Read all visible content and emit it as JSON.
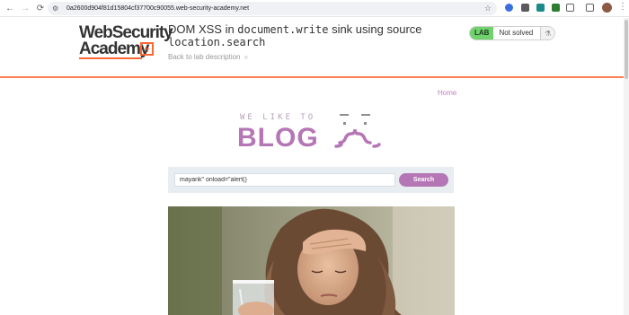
{
  "browser": {
    "url": "0a2600d904f81d15804cf37700c90055.web-security-academy.net",
    "back_glyph": "←",
    "forward_glyph": "→",
    "reload_glyph": "⟳",
    "site_info_glyph": "⚙",
    "star_glyph": "☆",
    "menu_glyph": "⋮"
  },
  "lab": {
    "logo_line1": "WebSecurity",
    "logo_line2": "Academy",
    "logo_badge": "ϟ",
    "title_prefix": "DOM XSS in ",
    "title_code1": "document.write",
    "title_middle": " sink using source",
    "title_code2": "location.search",
    "back_link": "Back to lab description",
    "back_chevron": "»",
    "status_label": "LAB",
    "status_text": "Not solved",
    "status_icon_glyph": "⚗",
    "colors": {
      "accent_orange": "#ff6633",
      "lab_green": "#70d16d"
    }
  },
  "blog": {
    "home_link": "Home",
    "tagline": "WE LIKE TO",
    "brand": "BLOG",
    "search": {
      "value": "mayank\" onload=\"alert()",
      "button_label": "Search"
    },
    "accent_purple": "#b576b5"
  }
}
